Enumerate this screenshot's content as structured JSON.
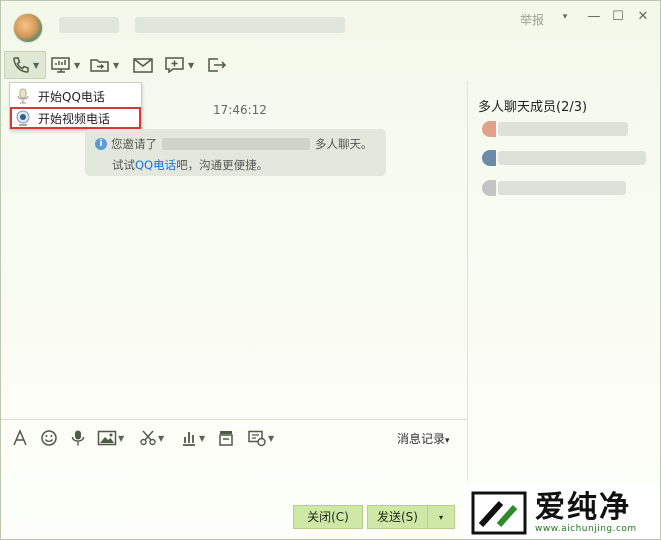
{
  "window": {
    "report_label": "举报",
    "buttons": {
      "dropdown": "▾",
      "minimize": "—",
      "maximize": "☐",
      "close": "✕"
    }
  },
  "toolbar": {
    "items": [
      {
        "icon": "phone-icon",
        "has_caret": true,
        "active": true
      },
      {
        "icon": "screen-share-icon",
        "has_caret": true
      },
      {
        "icon": "file-transfer-icon",
        "has_caret": true
      },
      {
        "icon": "mail-icon",
        "has_caret": false
      },
      {
        "icon": "add-app-icon",
        "has_caret": true
      },
      {
        "icon": "exit-group-icon",
        "has_caret": false
      }
    ]
  },
  "call_menu": {
    "items": [
      {
        "label": "开始QQ电话",
        "icon": "microphone-icon"
      },
      {
        "label": "开始视频电话",
        "icon": "webcam-icon",
        "highlighted": true
      }
    ]
  },
  "chat": {
    "time": "17:46:12",
    "notice": {
      "prefix": "您邀请了",
      "suffix": "多人聊天。",
      "line2_prefix": "试试",
      "link": "QQ电话",
      "line2_suffix": "吧，沟通更便捷。"
    }
  },
  "members_panel": {
    "title": "多人聊天成员(2/3)",
    "members": [
      {
        "avatar_color": "#e0a08a"
      },
      {
        "avatar_color": "#6f8aa6"
      },
      {
        "avatar_color": "#b7b7b7"
      }
    ]
  },
  "input_toolbar": {
    "tools": [
      {
        "icon": "font-icon"
      },
      {
        "icon": "emoji-icon"
      },
      {
        "icon": "voice-icon"
      },
      {
        "icon": "image-icon",
        "has_caret": true
      },
      {
        "icon": "screenshot-scissors-icon",
        "has_caret": true
      },
      {
        "icon": "music-icon",
        "has_caret": true
      },
      {
        "icon": "shake-icon"
      },
      {
        "icon": "more-icon",
        "has_caret": true
      }
    ],
    "history_label": "消息记录",
    "history_caret": "▾"
  },
  "buttons": {
    "close_label": "关闭(C)",
    "send_label": "发送(S)",
    "send_caret": "▾"
  },
  "watermark": {
    "text": "爱纯净",
    "url": "www.aichunjing.com"
  },
  "colors": {
    "accent_green": "#cfe7a7",
    "link_blue": "#1d6fd8",
    "highlight_red": "#d43a3a",
    "info_blue": "#5b9bd6"
  }
}
